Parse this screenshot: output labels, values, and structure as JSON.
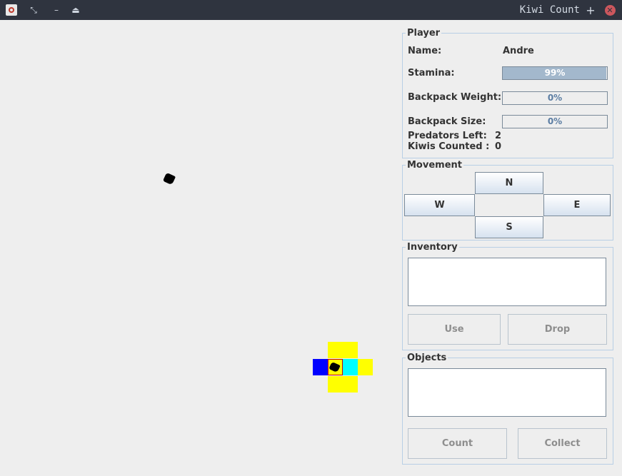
{
  "window": {
    "title": "Kiwi Count",
    "controls": [
      "restore-icon",
      "minimize-icon",
      "eject-icon",
      "plus-icon",
      "close-icon"
    ],
    "close_color": "#cc575d"
  },
  "player": {
    "legend": "Player",
    "name_label": "Name:",
    "name_value": "Andre",
    "stamina_label": "Stamina:",
    "stamina_text": "99%",
    "stamina_fraction": 0.99,
    "weight_label": "Backpack Weight:",
    "weight_text": "0%",
    "weight_fraction": 0,
    "size_label": "Backpack Size:",
    "size_text": "0%",
    "size_fraction": 0,
    "predators_label": "Predators Left:",
    "predators_value": "2",
    "kiwis_label": "Kiwis Counted :",
    "kiwis_value": "0"
  },
  "movement": {
    "legend": "Movement",
    "north": "N",
    "west": "W",
    "east": "E",
    "south": "S"
  },
  "inventory": {
    "legend": "Inventory",
    "use_label": "Use",
    "drop_label": "Drop"
  },
  "objects": {
    "legend": "Objects",
    "count_label": "Count",
    "collect_label": "Collect"
  },
  "map_colors": {
    "yellow": "#ffff00",
    "blue": "#0000ff",
    "cyan": "#00ffff",
    "player_border": "#cc0000"
  }
}
